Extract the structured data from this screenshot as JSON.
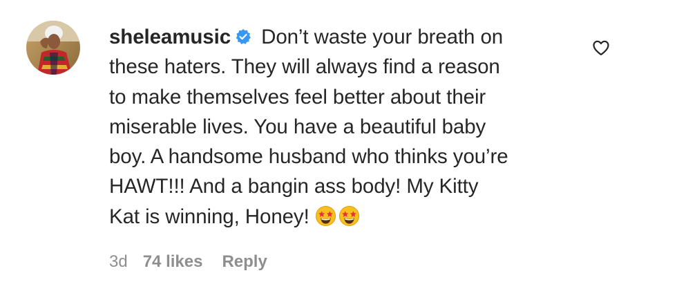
{
  "comment": {
    "username": "sheleamusic",
    "verified_icon": "verified-badge-icon",
    "text_lines": [
      " Don’t waste your breath on",
      "these haters. They will always find a reason",
      "to make themselves feel better about their",
      "miserable lives. You have a beautiful baby",
      "boy. A handsome husband who thinks you’re",
      "HAWT!!! And a bangin ass body! My Kitty",
      "Kat is winning, Honey! "
    ],
    "emoji": [
      "star-struck-emoji",
      "star-struck-emoji"
    ],
    "time": "3d",
    "likes": "74 likes",
    "reply_label": "Reply",
    "like_icon": "heart-outline-icon"
  },
  "colors": {
    "text": "#262626",
    "meta": "#8e8e8e",
    "verified": "#3897f0"
  }
}
